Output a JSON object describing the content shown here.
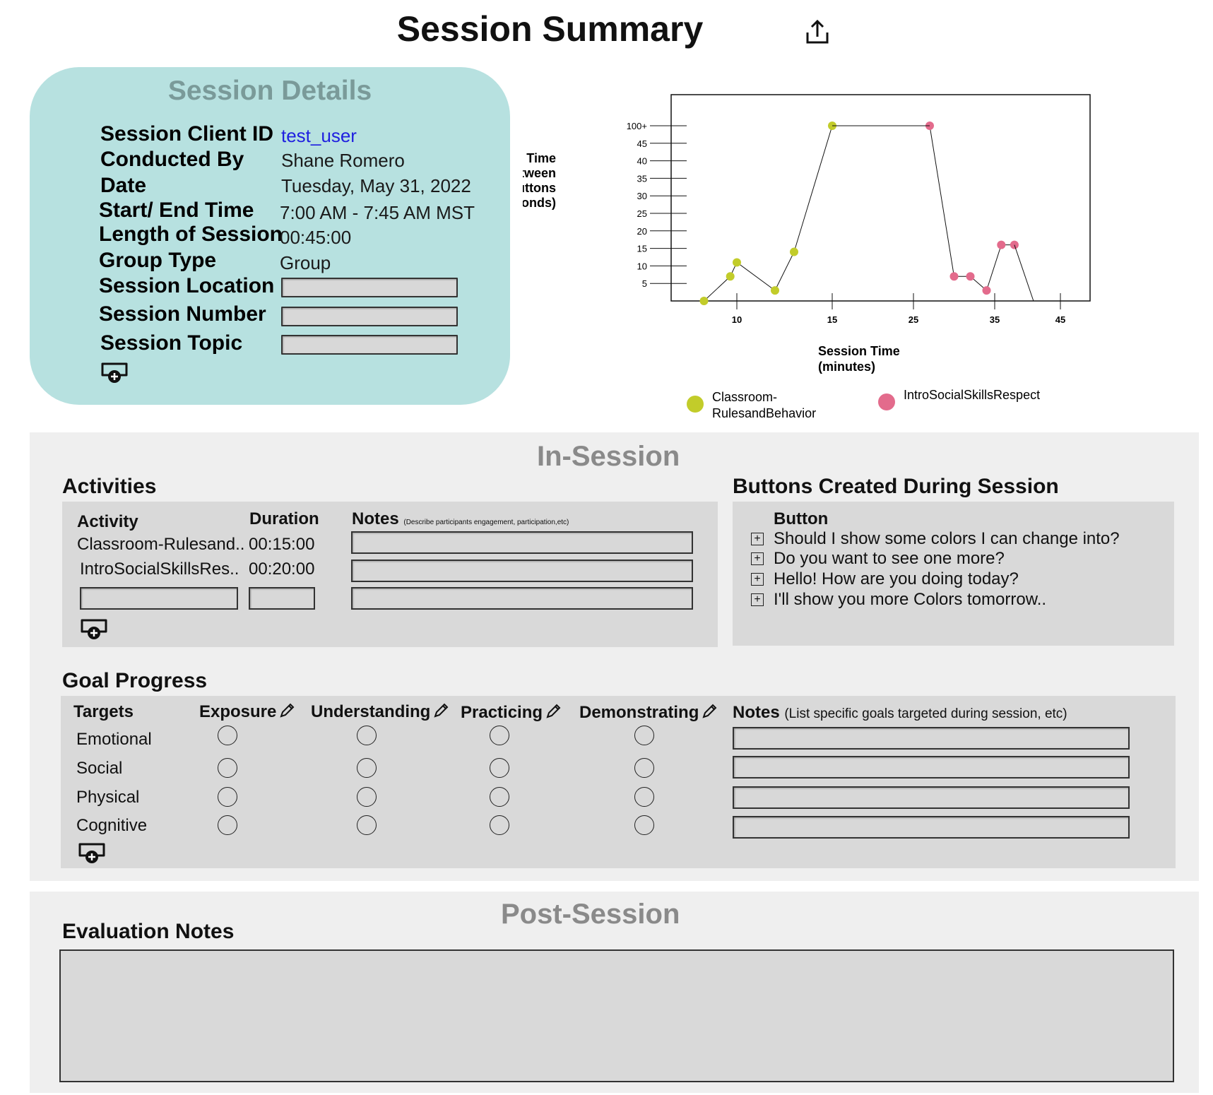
{
  "page": {
    "title": "Session Summary",
    "share_icon": "share-icon"
  },
  "details": {
    "heading": "Session Details",
    "fields": [
      {
        "label": "Session Client ID",
        "value": "test_user"
      },
      {
        "label": "Conducted By",
        "value": "Shane Romero"
      },
      {
        "label": "Date",
        "value": "Tuesday,  May 31, 2022"
      },
      {
        "label": "Start/ End Time",
        "value": "7:00 AM -  7:45 AM MST"
      },
      {
        "label": "Length of Session",
        "value": "00:45:00"
      },
      {
        "label": "Group Type",
        "value": "Group"
      },
      {
        "label": "Session Location",
        "value": ""
      },
      {
        "label": "Session Number",
        "value": ""
      },
      {
        "label": "Session Topic",
        "value": ""
      }
    ],
    "add_icon": "add-field-icon"
  },
  "chart_data": {
    "type": "line",
    "ylabel": "Interim Time Between Buttons (seconds)",
    "xlabel": "Session Time (minutes)",
    "y_ticks": [
      "100+",
      "45",
      "40",
      "35",
      "30",
      "25",
      "20",
      "15",
      "10",
      "5"
    ],
    "x_ticks": [
      "10",
      "15",
      "25",
      "35",
      "45"
    ],
    "series": [
      {
        "name": "Classroom-RulesandBehavior",
        "color": "#c2cc2a",
        "points": [
          [
            7.5,
            0
          ],
          [
            9.5,
            7
          ],
          [
            10,
            11
          ],
          [
            12,
            3
          ],
          [
            13,
            14
          ],
          [
            15,
            100
          ]
        ]
      },
      {
        "name": "IntroSocialSkillsRespect",
        "color": "#e36b8c",
        "points": [
          [
            27,
            100
          ],
          [
            30,
            7
          ],
          [
            32,
            7
          ],
          [
            34,
            3
          ],
          [
            36,
            16
          ],
          [
            38,
            16
          ]
        ]
      }
    ],
    "legend": [
      {
        "label_line1": "Classroom-",
        "label_line2": "RulesandBehavior",
        "color": "#c2cc2a"
      },
      {
        "label_line1": "IntroSocialSkillsRespect",
        "label_line2": "",
        "color": "#e36b8c"
      }
    ],
    "legend_position": "bottom",
    "ylabel_lines": [
      "Interim Time",
      "Between",
      "Buttons",
      "(seconds)"
    ],
    "xlabel_lines": [
      "Session Time",
      "(minutes)"
    ]
  },
  "in_session": {
    "heading": "In-Session",
    "activities": {
      "heading": "Activities",
      "col_activity": "Activity",
      "col_duration": "Duration",
      "col_notes": "Notes",
      "col_notes_hint": "(Describe participants engagement, participation,etc)",
      "rows": [
        {
          "activity": "Classroom-Rulesand..",
          "duration": "00:15:00",
          "notes": ""
        },
        {
          "activity": "IntroSocialSkillsRes..",
          "duration": "00:20:00",
          "notes": ""
        }
      ]
    },
    "buttons": {
      "heading": "Buttons Created During Session",
      "col_button": "Button",
      "items": [
        "Should I show some colors I can change into?",
        "Do you want to see one more?",
        "Hello! How are you doing today?",
        "I'll show you more Colors tomorrow.."
      ]
    },
    "goals": {
      "heading": "Goal Progress",
      "col_targets": "Targets",
      "levels": [
        "Exposure",
        "Understanding",
        "Practicing",
        "Demonstrating"
      ],
      "col_notes": "Notes",
      "col_notes_hint": "(List specific goals targeted during session, etc)",
      "targets": [
        "Emotional",
        "Social",
        "Physical",
        "Cognitive"
      ]
    }
  },
  "post_session": {
    "heading": "Post-Session",
    "eval_heading": "Evaluation Notes",
    "eval_value": ""
  }
}
